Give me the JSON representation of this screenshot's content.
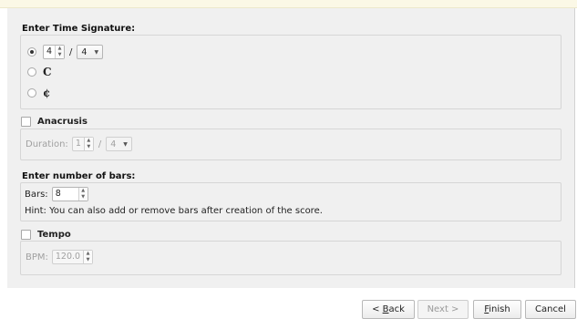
{
  "time_signature": {
    "title": "Enter Time Signature:",
    "numerator": "4",
    "separator": "/",
    "denominator": "4",
    "common_time_symbol": "C",
    "cut_time_symbol": "¢"
  },
  "anacrusis": {
    "title": "Anacrusis",
    "duration_label": "Duration:",
    "numerator": "1",
    "separator": "/",
    "denominator": "4"
  },
  "bars": {
    "title": "Enter number of bars:",
    "bars_label": "Bars:",
    "bars_value": "8",
    "hint": "Hint: You can also add or remove bars after creation of the score."
  },
  "tempo": {
    "title": "Tempo",
    "bpm_label": "BPM:",
    "bpm_value": "120.0"
  },
  "buttons": {
    "back_prefix": "< ",
    "back_mnemonic": "B",
    "back_rest": "ack",
    "next": "Next >",
    "finish_mnemonic": "F",
    "finish_rest": "inish",
    "cancel": "Cancel"
  }
}
